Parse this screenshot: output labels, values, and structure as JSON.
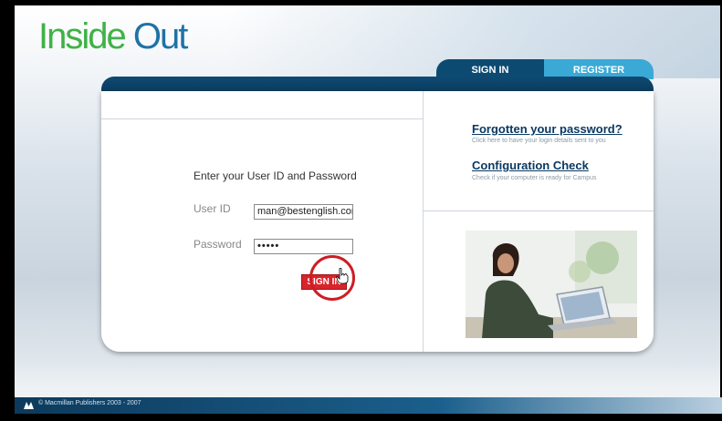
{
  "brand": {
    "logo_part1": "Inside ",
    "logo_part2": "Out"
  },
  "tabs": [
    {
      "label": "SIGN IN",
      "active": true
    },
    {
      "label": "REGISTER",
      "active": false
    }
  ],
  "login": {
    "prompt": "Enter your User ID and Password",
    "user_label": "User ID",
    "user_value": "man@bestenglish.com",
    "password_label": "Password",
    "password_value": "•••••",
    "signin_label": "SIGN IN"
  },
  "help": {
    "forgot_title": "Forgotten your password?",
    "forgot_desc": "Click here to have your login details sent to you",
    "config_title": "Configuration Check",
    "config_desc": "Check if your computer is ready for Campus"
  },
  "footer": {
    "copyright": "© Macmillan Publishers 2003 - 2007"
  },
  "colors": {
    "brand_green": "#3fb246",
    "brand_blue": "#1f72a6",
    "navy": "#0d4a72",
    "register_blue": "#3aa9d6",
    "signin_red": "#d8242b"
  }
}
